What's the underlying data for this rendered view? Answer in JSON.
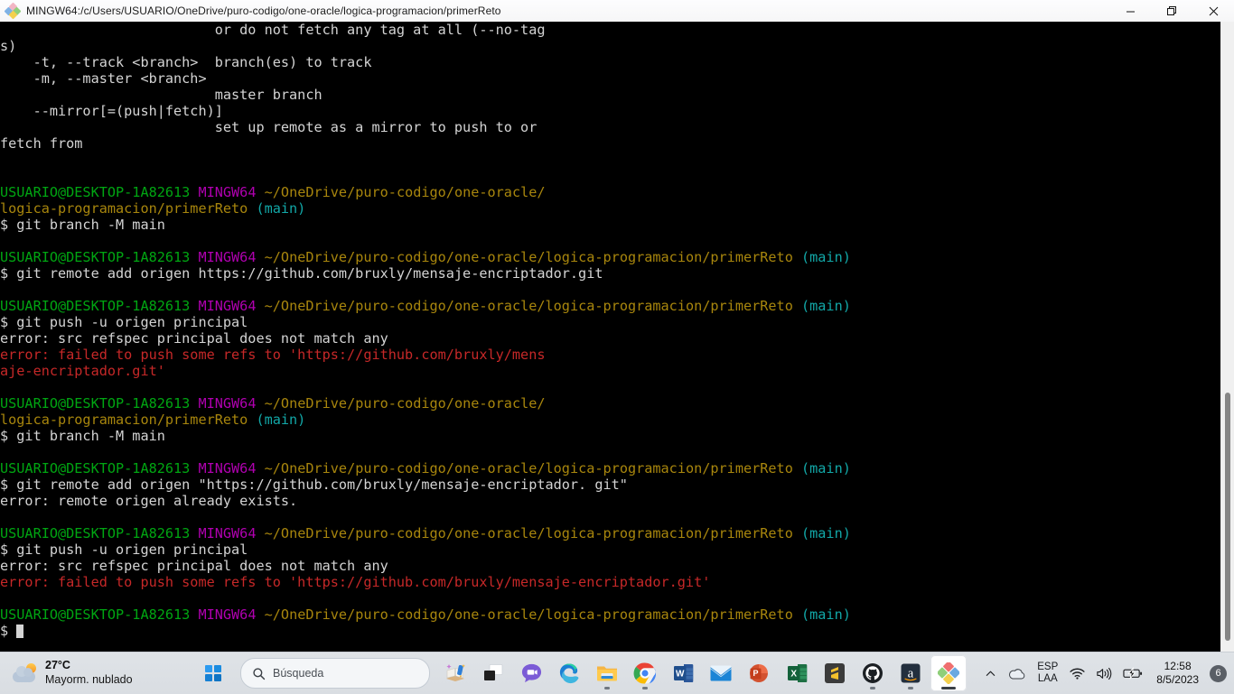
{
  "window": {
    "title": "MINGW64:/c/Users/USUARIO/OneDrive/puro-codigo/one-oracle/logica-programacion/primerReto",
    "icon": "gitbash-icon",
    "buttons": {
      "minimize": "minimize-icon",
      "maximize": "restore-icon",
      "close": "close-icon"
    }
  },
  "terminal": {
    "prompt_user": "USUARIO@DESKTOP-1A82613",
    "prompt_shell": "MINGW64",
    "branch": "(main)",
    "lines": [
      {
        "id": "l0",
        "segments": [
          {
            "t": "                          or do not fetch any tag at all (--no-tag",
            "c": "white"
          }
        ]
      },
      {
        "id": "l1",
        "segments": [
          {
            "t": "s)",
            "c": "white"
          }
        ]
      },
      {
        "id": "l2",
        "segments": [
          {
            "t": "    -t, --track <branch>  branch(es) to track",
            "c": "white"
          }
        ]
      },
      {
        "id": "l3",
        "segments": [
          {
            "t": "    -m, --master <branch>",
            "c": "white"
          }
        ]
      },
      {
        "id": "l4",
        "segments": [
          {
            "t": "                          master branch",
            "c": "white"
          }
        ]
      },
      {
        "id": "l5",
        "segments": [
          {
            "t": "    --mirror[=(push|fetch)]",
            "c": "white"
          }
        ]
      },
      {
        "id": "l6",
        "segments": [
          {
            "t": "                          set up remote as a mirror to push to or",
            "c": "white"
          }
        ]
      },
      {
        "id": "l7",
        "segments": [
          {
            "t": "fetch from",
            "c": "white"
          }
        ]
      },
      {
        "id": "l8",
        "segments": [
          {
            "t": "",
            "c": "white"
          }
        ]
      },
      {
        "id": "l9",
        "segments": [
          {
            "t": "",
            "c": "white"
          }
        ]
      },
      {
        "id": "l10",
        "segments": [
          {
            "t": "USUARIO@DESKTOP-1A82613",
            "c": "green"
          },
          {
            "t": " ",
            "c": "white"
          },
          {
            "t": "MINGW64",
            "c": "purple"
          },
          {
            "t": " ",
            "c": "white"
          },
          {
            "t": "~/OneDrive/puro-codigo/one-oracle/",
            "c": "yellow"
          }
        ]
      },
      {
        "id": "l11",
        "segments": [
          {
            "t": "logica-programacion/primerReto",
            "c": "yellow"
          },
          {
            "t": " ",
            "c": "white"
          },
          {
            "t": "(main)",
            "c": "cyan"
          }
        ]
      },
      {
        "id": "l12",
        "segments": [
          {
            "t": "$ git branch -M main",
            "c": "white"
          }
        ]
      },
      {
        "id": "l13",
        "segments": [
          {
            "t": "",
            "c": "white"
          }
        ]
      },
      {
        "id": "l14",
        "segments": [
          {
            "t": "USUARIO@DESKTOP-1A82613",
            "c": "green"
          },
          {
            "t": " ",
            "c": "white"
          },
          {
            "t": "MINGW64",
            "c": "purple"
          },
          {
            "t": " ",
            "c": "white"
          },
          {
            "t": "~/OneDrive/puro-codigo/one-oracle/logica-programacion/primerReto",
            "c": "yellow"
          },
          {
            "t": " ",
            "c": "white"
          },
          {
            "t": "(main)",
            "c": "cyan"
          }
        ]
      },
      {
        "id": "l15",
        "segments": [
          {
            "t": "$ git remote add origen https://github.com/bruxly/mensaje-encriptador.git",
            "c": "white"
          }
        ]
      },
      {
        "id": "l16",
        "segments": [
          {
            "t": "",
            "c": "white"
          }
        ]
      },
      {
        "id": "l17",
        "segments": [
          {
            "t": "USUARIO@DESKTOP-1A82613",
            "c": "green"
          },
          {
            "t": " ",
            "c": "white"
          },
          {
            "t": "MINGW64",
            "c": "purple"
          },
          {
            "t": " ",
            "c": "white"
          },
          {
            "t": "~/OneDrive/puro-codigo/one-oracle/logica-programacion/primerReto",
            "c": "yellow"
          },
          {
            "t": " ",
            "c": "white"
          },
          {
            "t": "(main)",
            "c": "cyan"
          }
        ]
      },
      {
        "id": "l18",
        "segments": [
          {
            "t": "$ git push -u origen principal",
            "c": "white"
          }
        ]
      },
      {
        "id": "l19",
        "segments": [
          {
            "t": "error: src refspec principal does not match any",
            "c": "white"
          }
        ]
      },
      {
        "id": "l20",
        "segments": [
          {
            "t": "error: failed to push some refs to 'https://github.com/bruxly/mens",
            "c": "red"
          }
        ]
      },
      {
        "id": "l21",
        "segments": [
          {
            "t": "aje-encriptador.git'",
            "c": "red"
          }
        ]
      },
      {
        "id": "l22",
        "segments": [
          {
            "t": "",
            "c": "white"
          }
        ]
      },
      {
        "id": "l23",
        "segments": [
          {
            "t": "USUARIO@DESKTOP-1A82613",
            "c": "green"
          },
          {
            "t": " ",
            "c": "white"
          },
          {
            "t": "MINGW64",
            "c": "purple"
          },
          {
            "t": " ",
            "c": "white"
          },
          {
            "t": "~/OneDrive/puro-codigo/one-oracle/",
            "c": "yellow"
          }
        ]
      },
      {
        "id": "l24",
        "segments": [
          {
            "t": "logica-programacion/primerReto",
            "c": "yellow"
          },
          {
            "t": " ",
            "c": "white"
          },
          {
            "t": "(main)",
            "c": "cyan"
          }
        ]
      },
      {
        "id": "l25",
        "segments": [
          {
            "t": "$ git branch -M main",
            "c": "white"
          }
        ]
      },
      {
        "id": "l26",
        "segments": [
          {
            "t": "",
            "c": "white"
          }
        ]
      },
      {
        "id": "l27",
        "segments": [
          {
            "t": "USUARIO@DESKTOP-1A82613",
            "c": "green"
          },
          {
            "t": " ",
            "c": "white"
          },
          {
            "t": "MINGW64",
            "c": "purple"
          },
          {
            "t": " ",
            "c": "white"
          },
          {
            "t": "~/OneDrive/puro-codigo/one-oracle/logica-programacion/primerReto",
            "c": "yellow"
          },
          {
            "t": " ",
            "c": "white"
          },
          {
            "t": "(main)",
            "c": "cyan"
          }
        ]
      },
      {
        "id": "l28",
        "segments": [
          {
            "t": "$ git remote add origen \"https://github.com/bruxly/mensaje-encriptador. git\"",
            "c": "white"
          }
        ]
      },
      {
        "id": "l29",
        "segments": [
          {
            "t": "error: remote origen already exists.",
            "c": "white"
          }
        ]
      },
      {
        "id": "l30",
        "segments": [
          {
            "t": "",
            "c": "white"
          }
        ]
      },
      {
        "id": "l31",
        "segments": [
          {
            "t": "USUARIO@DESKTOP-1A82613",
            "c": "green"
          },
          {
            "t": " ",
            "c": "white"
          },
          {
            "t": "MINGW64",
            "c": "purple"
          },
          {
            "t": " ",
            "c": "white"
          },
          {
            "t": "~/OneDrive/puro-codigo/one-oracle/logica-programacion/primerReto",
            "c": "yellow"
          },
          {
            "t": " ",
            "c": "white"
          },
          {
            "t": "(main)",
            "c": "cyan"
          }
        ]
      },
      {
        "id": "l32",
        "segments": [
          {
            "t": "$ git push -u origen principal",
            "c": "white"
          }
        ]
      },
      {
        "id": "l33",
        "segments": [
          {
            "t": "error: src refspec principal does not match any",
            "c": "white"
          }
        ]
      },
      {
        "id": "l34",
        "segments": [
          {
            "t": "error: failed to push some refs to 'https://github.com/bruxly/mensaje-encriptador.git'",
            "c": "red"
          }
        ]
      },
      {
        "id": "l35",
        "segments": [
          {
            "t": "",
            "c": "white"
          }
        ]
      },
      {
        "id": "l36",
        "segments": [
          {
            "t": "USUARIO@DESKTOP-1A82613",
            "c": "green"
          },
          {
            "t": " ",
            "c": "white"
          },
          {
            "t": "MINGW64",
            "c": "purple"
          },
          {
            "t": " ",
            "c": "white"
          },
          {
            "t": "~/OneDrive/puro-codigo/one-oracle/logica-programacion/primerReto",
            "c": "yellow"
          },
          {
            "t": " ",
            "c": "white"
          },
          {
            "t": "(main)",
            "c": "cyan"
          }
        ]
      },
      {
        "id": "l37",
        "segments": [
          {
            "t": "$ ",
            "c": "white"
          },
          {
            "t": "",
            "c": "cursor"
          }
        ]
      }
    ],
    "colors": {
      "background": "#000000",
      "foreground": "#d4d4d4",
      "green": "#00a612",
      "purple": "#b000b0",
      "yellow": "#a8860d",
      "cyan": "#12a8a8",
      "red": "#c62828"
    }
  },
  "taskbar": {
    "weather": {
      "temperature": "27°C",
      "description": "Mayorm. nublado",
      "icon": "partly-cloudy-icon"
    },
    "start": {
      "label": "Inicio",
      "icon": "windows-logo-icon"
    },
    "search": {
      "placeholder": "Búsqueda",
      "icon": "search-icon"
    },
    "apps": [
      {
        "name": "widgets-copilot-icon",
        "label": "Widgets",
        "running": false,
        "active": false
      },
      {
        "name": "task-view-icon",
        "label": "Vista de tareas",
        "running": false,
        "active": false
      },
      {
        "name": "chat-teams-icon",
        "label": "Chat",
        "running": false,
        "active": false
      },
      {
        "name": "microsoft-edge-icon",
        "label": "Microsoft Edge",
        "running": false,
        "active": false
      },
      {
        "name": "file-explorer-icon",
        "label": "Explorador de archivos",
        "running": true,
        "active": false
      },
      {
        "name": "google-chrome-icon",
        "label": "Google Chrome",
        "running": true,
        "active": false
      },
      {
        "name": "microsoft-word-icon",
        "label": "Word",
        "running": false,
        "active": false
      },
      {
        "name": "mail-icon",
        "label": "Correo",
        "running": false,
        "active": false
      },
      {
        "name": "microsoft-powerpoint-icon",
        "label": "PowerPoint",
        "running": false,
        "active": false
      },
      {
        "name": "microsoft-excel-icon",
        "label": "Excel",
        "running": false,
        "active": false
      },
      {
        "name": "sublime-text-icon",
        "label": "Sublime Text",
        "running": false,
        "active": false
      },
      {
        "name": "github-desktop-icon",
        "label": "GitHub Desktop",
        "running": true,
        "active": false
      },
      {
        "name": "amazon-icon",
        "label": "Amazon",
        "running": true,
        "active": false
      },
      {
        "name": "git-bash-icon",
        "label": "Git Bash",
        "running": true,
        "active": true
      }
    ],
    "tray": {
      "overflow_icon": "chevron-up-icon",
      "onedrive_icon": "onedrive-cloud-icon",
      "keyboard_line1": "ESP",
      "keyboard_line2": "LAA",
      "network_icon": "wifi-icon",
      "volume_icon": "speaker-icon",
      "battery_icon": "battery-charging-icon",
      "time": "12:58",
      "date": "8/5/2023",
      "notification_count": "6"
    }
  }
}
